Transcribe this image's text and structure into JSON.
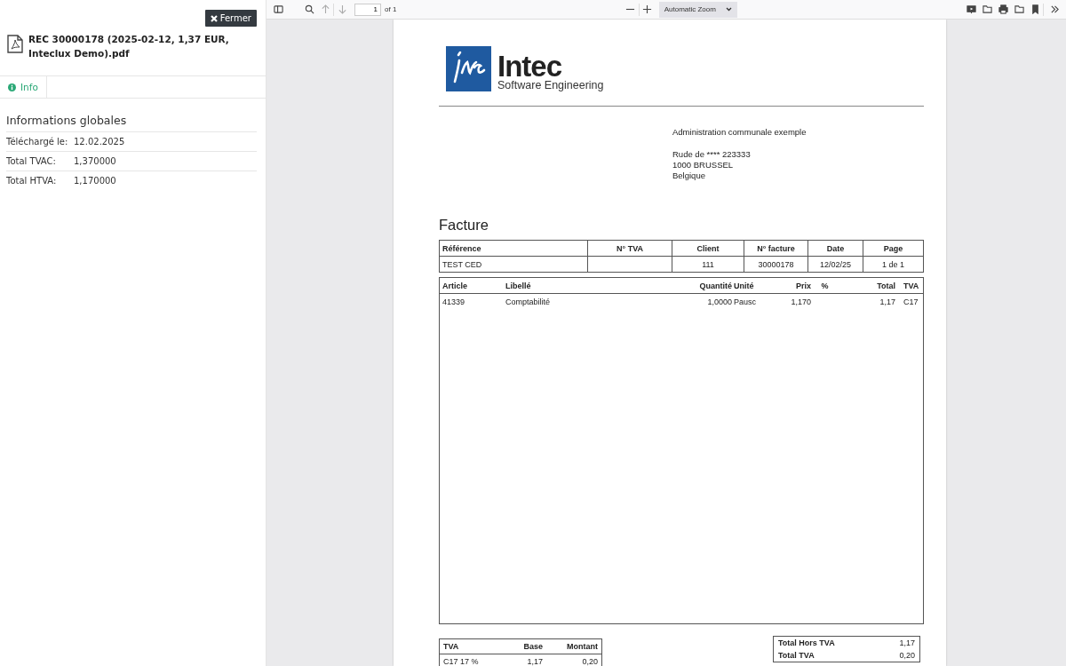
{
  "sidebar": {
    "close_button": "Fermer",
    "file_name": "REC 30000178 (2025-02-12, 1,37 EUR, Inteclux Demo).pdf",
    "tabs": [
      {
        "label": "Info",
        "selected": true
      }
    ],
    "section_title": "Informations globales",
    "fields": [
      {
        "label": "Téléchargé le:",
        "value": "12.02.2025"
      },
      {
        "label": "Total TVAC:",
        "value": "1,370000"
      },
      {
        "label": "Total HTVA:",
        "value": "1,170000"
      }
    ]
  },
  "viewer_toolbar": {
    "page_number": "1",
    "page_count": "of 1",
    "zoom": "Automatic Zoom"
  },
  "document": {
    "logo": {
      "name": "Intec",
      "tagline": "Software Engineering"
    },
    "recipient": "Administration communale exemple",
    "address": [
      "Rude de **** 223333",
      "1000 BRUSSEL",
      "Belgique"
    ],
    "title": "Facture",
    "header_table": {
      "columns": [
        "Référence",
        "N° TVA",
        "Client",
        "N° facture",
        "Date",
        "Page"
      ],
      "rows": [
        [
          "TEST CED",
          "",
          "111",
          "30000178",
          "12/02/25",
          "1 de 1"
        ]
      ]
    },
    "lines_table": {
      "columns": [
        "Article",
        "Libellé",
        "Quantité",
        "Unité",
        "Prix",
        "%",
        "Total",
        "TVA"
      ],
      "rows": [
        [
          "41339",
          "Comptabilité",
          "1,0000",
          "Pausc",
          "1,170",
          "",
          "1,17",
          "C17"
        ]
      ]
    },
    "vat_table": {
      "columns": [
        "TVA",
        "Base",
        "Montant"
      ],
      "rows": [
        [
          "C17 17 %",
          "1,17",
          "0,20"
        ]
      ]
    },
    "totals": [
      {
        "label": "Total Hors TVA",
        "value": "1,17"
      },
      {
        "label": "Total TVA",
        "value": "0,20"
      }
    ]
  }
}
